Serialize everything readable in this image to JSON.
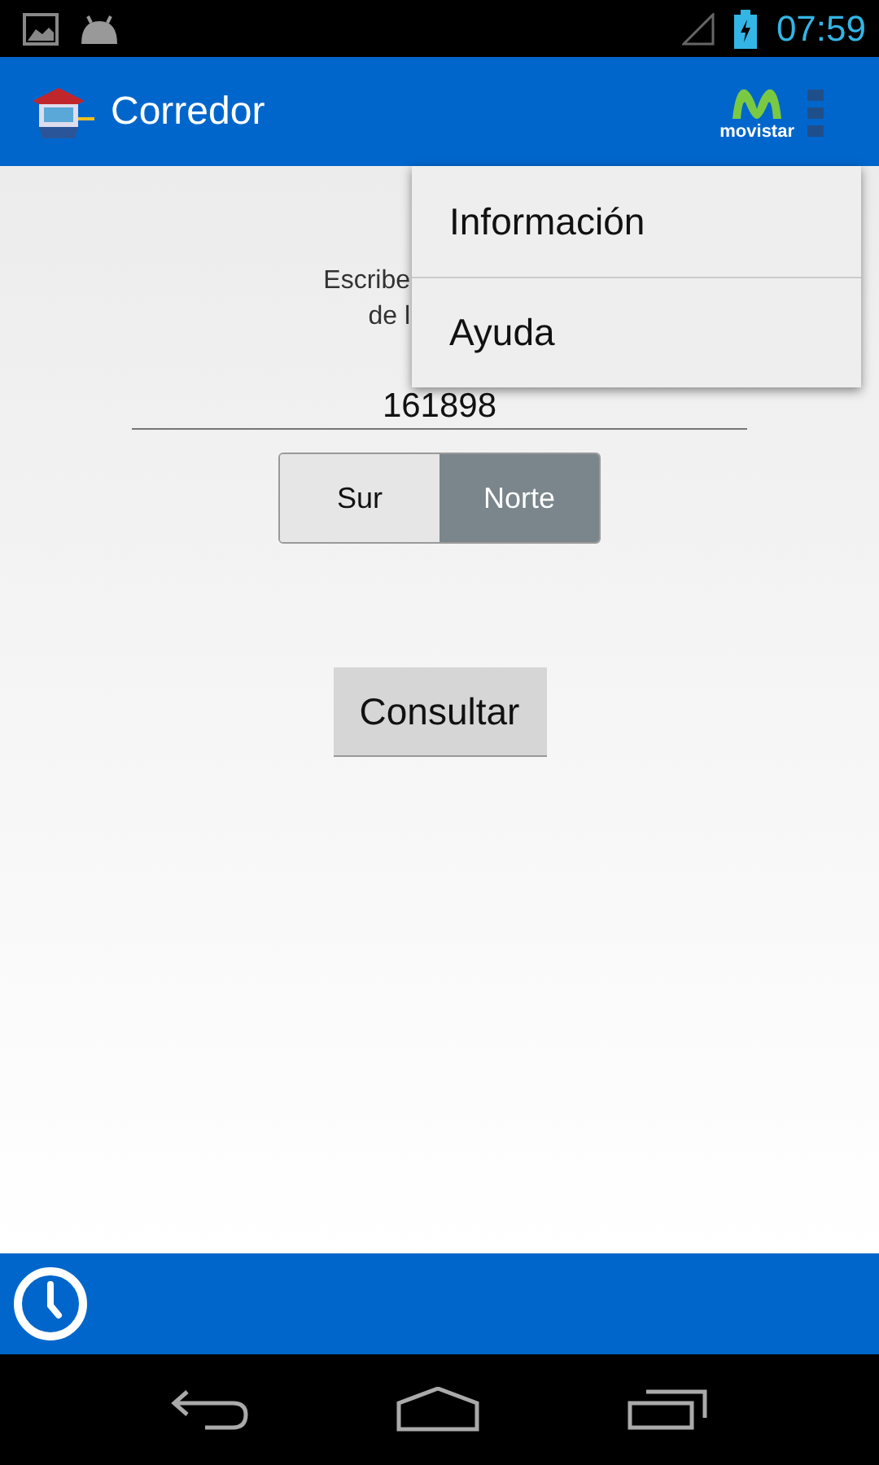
{
  "status_bar": {
    "time": "07:59"
  },
  "app_bar": {
    "title": "Corredor",
    "brand": "movistar"
  },
  "overflow_menu": {
    "items": [
      {
        "label": "Información"
      },
      {
        "label": "Ayuda"
      }
    ]
  },
  "form": {
    "prompt_lines": [
      "Escribe",
      "de l"
    ],
    "number": "161898",
    "direction": [
      {
        "label": "Sur",
        "selected": false
      },
      {
        "label": "Norte",
        "selected": true
      }
    ],
    "submit": "Consultar"
  }
}
